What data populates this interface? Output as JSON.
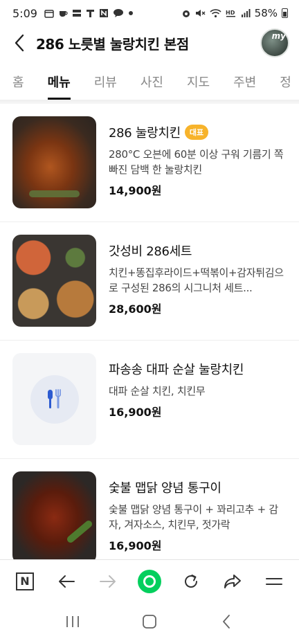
{
  "status_bar": {
    "time": "5:09",
    "battery_text": "58%",
    "left_icons": [
      "calendar-icon",
      "cup-icon",
      "samsung-card-icon",
      "t-icon",
      "n-icon",
      "talk-icon",
      "dot-icon"
    ],
    "right_icons": [
      "alarm-icon",
      "mute-icon",
      "wifi-icon",
      "hd-icon",
      "signal-icon",
      "battery-icon"
    ]
  },
  "header": {
    "title": "286 노릇별 눌랑치킨 본점",
    "avatar_label": "my"
  },
  "tabs": [
    {
      "label": "홈",
      "active": false
    },
    {
      "label": "메뉴",
      "active": true
    },
    {
      "label": "리뷰",
      "active": false
    },
    {
      "label": "사진",
      "active": false
    },
    {
      "label": "지도",
      "active": false
    },
    {
      "label": "주변",
      "active": false
    },
    {
      "label": "정",
      "active": false
    }
  ],
  "menu": [
    {
      "name": "286 눌랑치킨",
      "badge": "대표",
      "description": "280°C 오븐에 60분 이상 구워 기름기 쪽 빠진 담백 한 눌랑치킨",
      "price": "14,900원"
    },
    {
      "name": "갓성비 286세트",
      "badge": "",
      "description": "치킨+똥집후라이드+떡볶이+감자튀김으로 구성된 286의 시그니처 세트...",
      "price": "28,600원"
    },
    {
      "name": "파송송 대파 순살 눌랑치킨",
      "badge": "",
      "description": "대파 순살 치킨, 치킨무",
      "price": "16,900원"
    },
    {
      "name": "숯불 맵닭 양념 통구이",
      "badge": "",
      "description": "숯불 맵닭 양념 통구이 + 꽈리고추 + 감자, 겨자소스, 치킨무, 젓가락",
      "price": "16,900원"
    }
  ],
  "browser_bar": {
    "n_label": "N",
    "icons": [
      "naver-n-icon",
      "back-arrow-icon",
      "forward-arrow-icon",
      "green-dot-icon",
      "refresh-icon",
      "share-icon",
      "menu-icon"
    ]
  },
  "colors": {
    "badge": "#f7b32b",
    "naver_green": "#03cf5d",
    "active_tab": "#111111",
    "inactive_tab": "#888888"
  }
}
